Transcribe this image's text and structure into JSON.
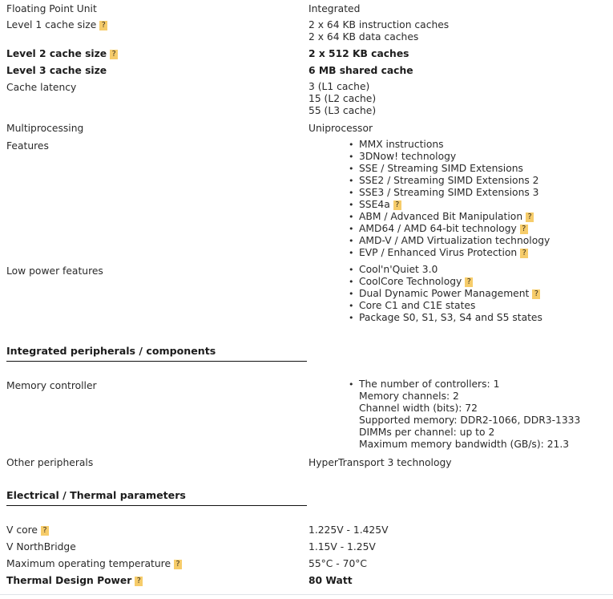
{
  "help_badge": {
    "glyph": "?",
    "color": "#f6cc6a"
  },
  "bullet_glyph": "•",
  "rows": {
    "fpu": {
      "label": "Floating Point Unit",
      "value": "Integrated"
    },
    "l1": {
      "label": "Level 1 cache size",
      "value_line1": "2 x 64 KB instruction caches",
      "value_line2": "2 x 64 KB data caches"
    },
    "l2": {
      "label": "Level 2 cache size",
      "value": "2 x 512 KB caches"
    },
    "l3": {
      "label": "Level 3 cache size",
      "value": "6 MB shared cache"
    },
    "cache_latency": {
      "label": "Cache latency",
      "value_line1": "3 (L1 cache)",
      "value_line2": "15 (L2 cache)",
      "value_line3": "55 (L3 cache)"
    },
    "multiprocessing": {
      "label": "Multiprocessing",
      "value": "Uniprocessor"
    },
    "features": {
      "label": "Features"
    },
    "low_power": {
      "label": "Low power features"
    },
    "memory_controller": {
      "label": "Memory controller"
    },
    "other_peripherals": {
      "label": "Other peripherals",
      "value": "HyperTransport 3 technology"
    },
    "v_core": {
      "label": "V core",
      "value": "1.225V - 1.425V"
    },
    "v_northbridge": {
      "label": "V NorthBridge",
      "value": "1.15V - 1.25V"
    },
    "max_temp": {
      "label": "Maximum operating temperature",
      "value": "55°C - 70°C"
    },
    "tdp": {
      "label": "Thermal Design Power",
      "value": "80 Watt"
    }
  },
  "features_list": [
    {
      "text": "MMX instructions",
      "help": false
    },
    {
      "text": "3DNow! technology",
      "help": false
    },
    {
      "text": "SSE / Streaming SIMD Extensions",
      "help": false
    },
    {
      "text": "SSE2 / Streaming SIMD Extensions 2",
      "help": false
    },
    {
      "text": "SSE3 / Streaming SIMD Extensions 3",
      "help": false
    },
    {
      "text": "SSE4a",
      "help": true
    },
    {
      "text": "ABM / Advanced Bit Manipulation",
      "help": true
    },
    {
      "text": "AMD64 / AMD 64-bit technology",
      "help": true
    },
    {
      "text": "AMD-V / AMD Virtualization technology",
      "help": false
    },
    {
      "text": "EVP / Enhanced Virus Protection",
      "help": true
    }
  ],
  "low_power_list": [
    {
      "text": "Cool'n'Quiet 3.0",
      "help": false
    },
    {
      "text": "CoolCore Technology",
      "help": true
    },
    {
      "text": "Dual Dynamic Power Management",
      "help": true
    },
    {
      "text": "Core C1 and C1E states",
      "help": false
    },
    {
      "text": "Package S0, S1, S3, S4 and S5 states",
      "help": false
    }
  ],
  "memory_controller_lines": [
    "The number of controllers: 1",
    "Memory channels: 2",
    "Channel width (bits): 72",
    "Supported memory: DDR2-1066, DDR3-1333",
    "DIMMs per channel: up to 2",
    "Maximum memory bandwidth (GB/s): 21.3"
  ],
  "sections": {
    "integrated_peripherals": "Integrated peripherals / components",
    "electrical_thermal": "Electrical / Thermal parameters"
  }
}
